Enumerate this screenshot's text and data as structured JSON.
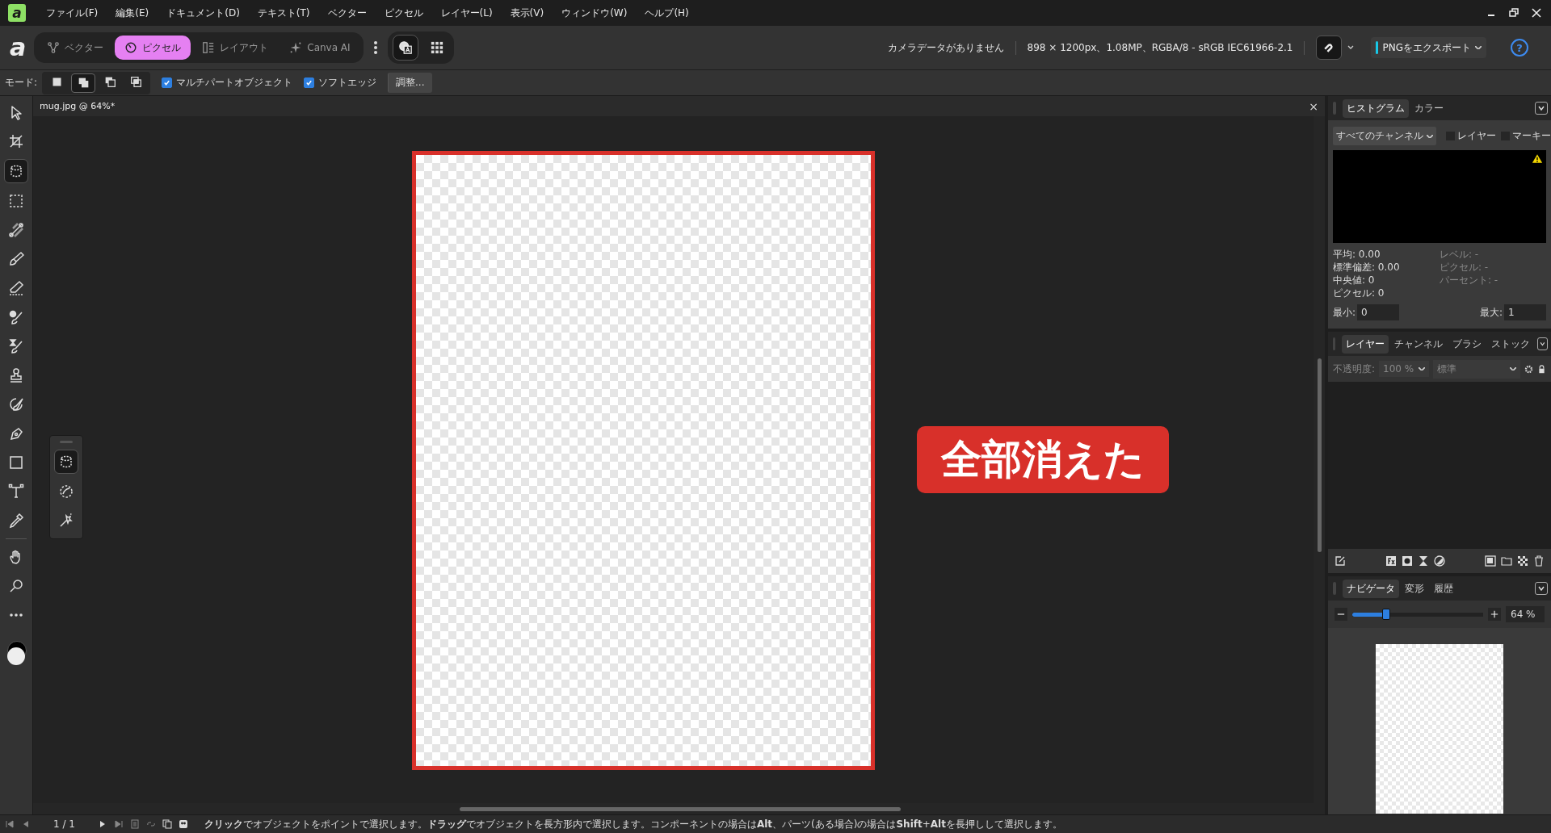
{
  "menubar": {
    "logo": "a",
    "items": [
      "ファイル(F)",
      "編集(E)",
      "ドキュメント(D)",
      "テキスト(T)",
      "ベクター",
      "ピクセル",
      "レイヤー(L)",
      "表示(V)",
      "ウィンドウ(W)",
      "ヘルプ(H)"
    ]
  },
  "toolbar": {
    "logo": "a",
    "personas": [
      {
        "label": "ベクター",
        "kind": "vector",
        "selected": false
      },
      {
        "label": "ピクセル",
        "kind": "pixel",
        "selected": true
      },
      {
        "label": "レイアウト",
        "kind": "layout",
        "selected": false
      },
      {
        "label": "Canva AI",
        "kind": "ai",
        "selected": false
      }
    ],
    "camera": "カメラデータがありません",
    "document_info": "898 × 1200px、1.08MP、RGBA/8 - sRGB IEC61966-2.1",
    "export": "PNGをエクスポート",
    "help": "?"
  },
  "context_bar": {
    "mode_label": "モード:",
    "modes": [
      {
        "kind": "new",
        "selected": false
      },
      {
        "kind": "add",
        "selected": true
      },
      {
        "kind": "subtract",
        "selected": false
      },
      {
        "kind": "intersect",
        "selected": false
      }
    ],
    "options": [
      {
        "label": "マルチパートオブジェクト",
        "checked": true
      },
      {
        "label": "ソフトエッジ",
        "checked": true
      }
    ],
    "adjust": "調整..."
  },
  "tools": [
    {
      "kind": "pointer",
      "selected": false
    },
    {
      "kind": "crop",
      "selected": false
    },
    {
      "kind": "selectbrush",
      "selected": true
    },
    {
      "kind": "marquee",
      "selected": false
    },
    {
      "kind": "gradient",
      "selected": false
    },
    {
      "kind": "brush",
      "selected": false
    },
    {
      "kind": "eraser",
      "selected": false
    },
    {
      "kind": "dodge",
      "selected": false
    },
    {
      "kind": "burn",
      "selected": false
    },
    {
      "kind": "stamp",
      "selected": false
    },
    {
      "kind": "smudge",
      "selected": false
    },
    {
      "kind": "pen",
      "selected": false
    },
    {
      "kind": "rectangle",
      "selected": false
    },
    {
      "kind": "text",
      "selected": false
    },
    {
      "kind": "eyedropper",
      "selected": false
    },
    {
      "kind": "hand",
      "selected": false
    },
    {
      "kind": "zoom",
      "selected": false
    },
    {
      "kind": "more",
      "selected": false
    }
  ],
  "flyout_tools": [
    {
      "kind": "selectbrush",
      "selected": true
    },
    {
      "kind": "freehand",
      "selected": false
    },
    {
      "kind": "wand",
      "selected": false
    }
  ],
  "document": {
    "title": "mug.jpg @ 64%*",
    "close": "×"
  },
  "callout": {
    "text": "全部消えた"
  },
  "histogram": {
    "tabs": [
      {
        "label": "ヒストグラム",
        "selected": true
      },
      {
        "label": "カラー",
        "selected": false
      }
    ],
    "channel": "すべてのチャンネル",
    "checks": [
      {
        "label": "レイヤー",
        "checked": false
      },
      {
        "label": "マーキー",
        "checked": false
      }
    ],
    "stats_left": [
      "平均: 0.00",
      "標準偏差: 0.00",
      "中央値: 0",
      "ピクセル: 0"
    ],
    "stats_right": [
      "レベル: -",
      "ピクセル: -",
      "パーセント: -"
    ],
    "min": {
      "label": "最小:",
      "value": "0"
    },
    "max": {
      "label": "最大:",
      "value": "1"
    }
  },
  "layers": {
    "tabs": [
      {
        "label": "レイヤー",
        "selected": true
      },
      {
        "label": "チャンネル",
        "selected": false
      },
      {
        "label": "ブラシ",
        "selected": false
      },
      {
        "label": "ストック",
        "selected": false
      }
    ],
    "opacity_label": "不透明度:",
    "opacity": "100 %",
    "blend_mode": "標準"
  },
  "navigator": {
    "tabs": [
      {
        "label": "ナビゲータ",
        "selected": true
      },
      {
        "label": "変形",
        "selected": false
      },
      {
        "label": "履歴",
        "selected": false
      }
    ],
    "zoom": {
      "level": 0.26,
      "value": "64 %"
    }
  },
  "status_bar": {
    "page": "1 / 1",
    "hint": "**クリック**でオブジェクトをポイントで選択します。**ドラッグ**でオブジェクトを長方形内で選択します。コンポーネントの場合は**Alt**、パーツ(ある場合)の場合は**Shift**+**Alt**を長押しして選択します。"
  }
}
